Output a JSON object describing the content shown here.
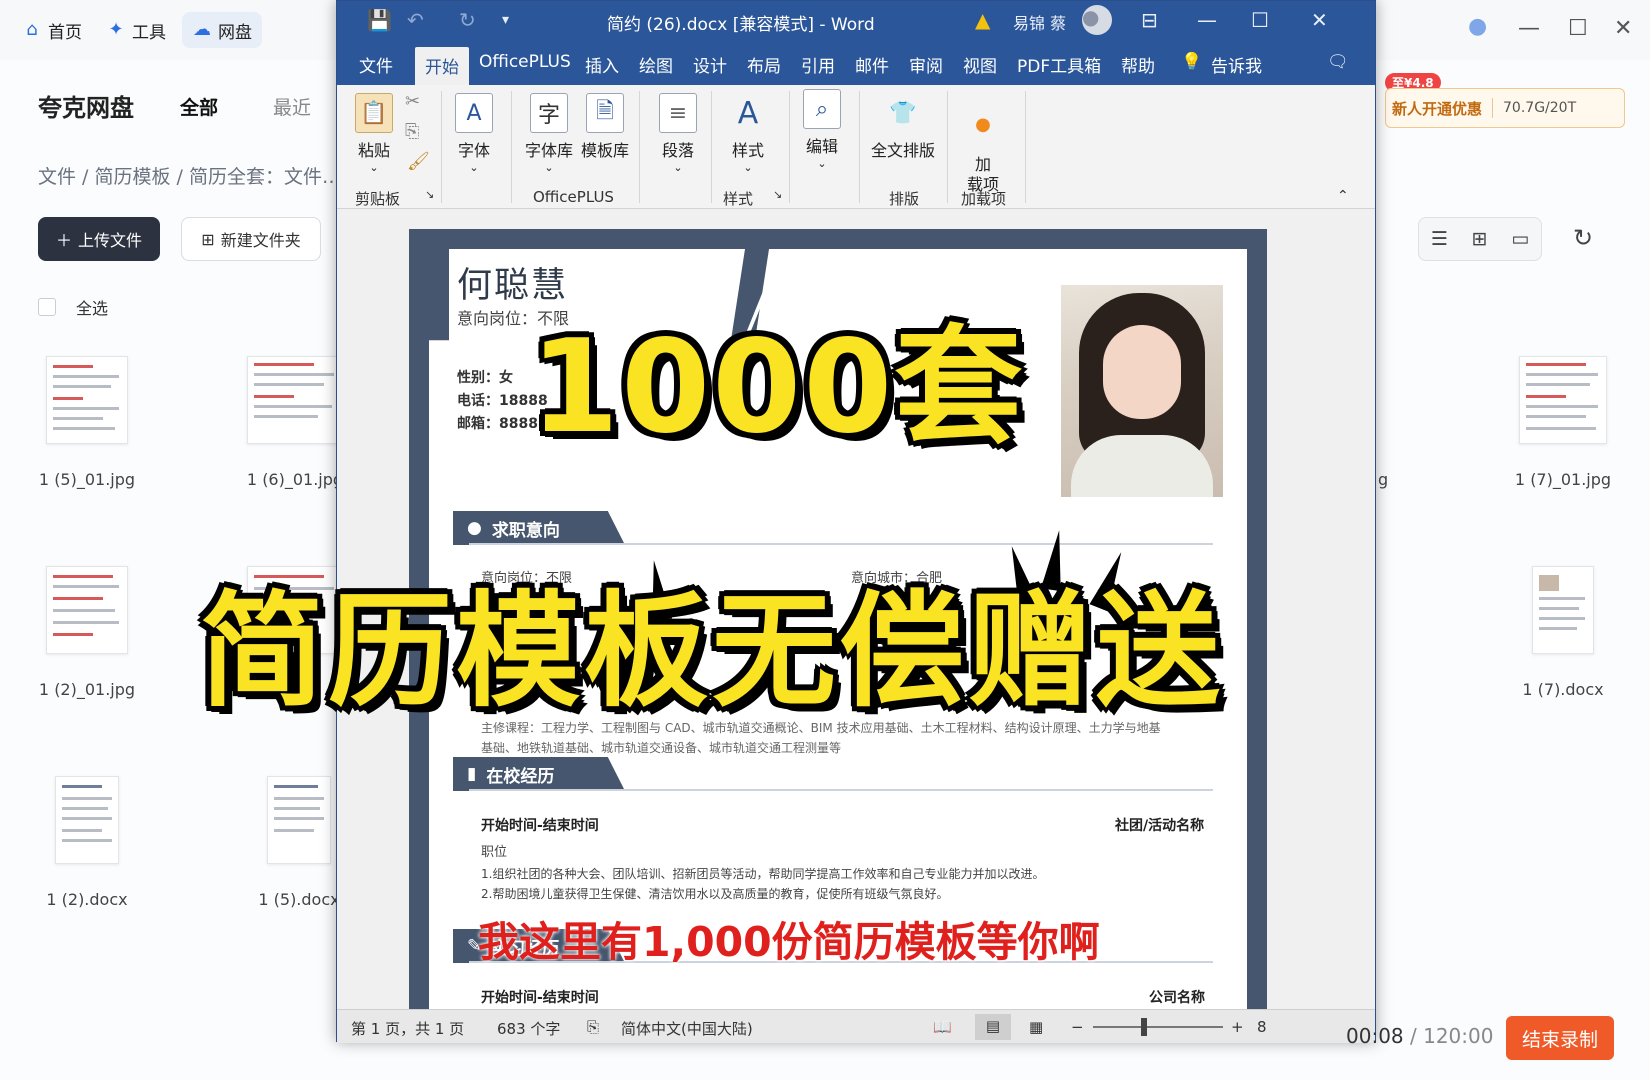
{
  "bg": {
    "nav": [
      {
        "label": "首页",
        "icon": "home-icon"
      },
      {
        "label": "工具",
        "icon": "sparkle-icon"
      },
      {
        "label": "网盘",
        "icon": "cloud-icon"
      }
    ],
    "brand": "夸克网盘",
    "tabs": [
      "全部",
      "最近"
    ],
    "breadcrumb": "文件 / 简历模板 / 简历全套：文件…",
    "upload_label": "上传文件",
    "newfolder_label": "新建文件夹",
    "select_all": "全选",
    "promo_badge": "至¥4.8",
    "promo_text": "新人开通优惠",
    "quota": "70.7G/20T",
    "files_left": [
      "1 (5)_01.jpg",
      "1 (6)_01.jpg",
      "1 (2)_01.jpg",
      "",
      "1 (2).docx",
      "1 (5).docx"
    ],
    "files_right": [
      "1 (7)_01.jpg",
      "1 (7).docx"
    ],
    "partial_g": "g"
  },
  "word": {
    "title": "简约 (26).docx [兼容模式] - Word",
    "user": "易锦 蔡",
    "menu": [
      "文件",
      "开始",
      "OfficePLUS",
      "插入",
      "绘图",
      "设计",
      "布局",
      "引用",
      "邮件",
      "审阅",
      "视图",
      "PDF工具箱",
      "帮助",
      "告诉我"
    ],
    "ribbon": {
      "paste": "粘贴",
      "font": "字体",
      "fontlib": "字体库",
      "templatelib": "模板库",
      "paragraph": "段落",
      "styles": "样式",
      "edit": "编辑",
      "fulllayout": "全文排版",
      "addin": "加\n载项"
    },
    "groups": {
      "clipboard": "剪贴板",
      "officeplus": "OfficePLUS",
      "style": "样式",
      "layout": "排版",
      "addins": "加载项"
    },
    "status": {
      "page": "第 1 页，共 1 页",
      "words": "683 个字",
      "lang": "简体中文(中国大陆)",
      "zoom_partial": "8"
    }
  },
  "resume": {
    "name": "何聪慧",
    "position": "意向岗位：不限",
    "info": [
      "性别：女",
      "电话：18888",
      "邮箱：88888"
    ],
    "section1": "求职意向",
    "intent_pos": "意向岗位：不限",
    "intent_city": "意向城市：合肥",
    "courses": "主修课程：工程力学、工程制图与 CAD、城市轨道交通概论、BIM 技术应用基础、土木工程材料、结构设计原理、土力学与地基",
    "courses2": "基础、地铁轨道基础、城市轨道交通设备、城市轨道交通工程测量等",
    "section2": "在校经历",
    "time1": "开始时间-结束时间",
    "club": "社团/活动名称",
    "role": "职位",
    "item1": "1.组织社团的各种大会、团队培训、招新团员等活动，帮助同学提高工作效率和自己专业能力并加以改进。",
    "item2": "2.帮助困境儿童获得卫生保健、清洁饮用水以及高质量的教育，促使所有班级气氛良好。",
    "section3": "实习经历",
    "time2": "开始时间-结束时间",
    "company": "公司名称"
  },
  "overlay": {
    "big1": "1000套",
    "big2": "简历模板无偿赠送",
    "subtitle": "我这里有1,000份简历模板等你啊"
  },
  "recorder": {
    "elapsed": "00:08",
    "total": "/ 120:00",
    "stop": "结束录制"
  }
}
